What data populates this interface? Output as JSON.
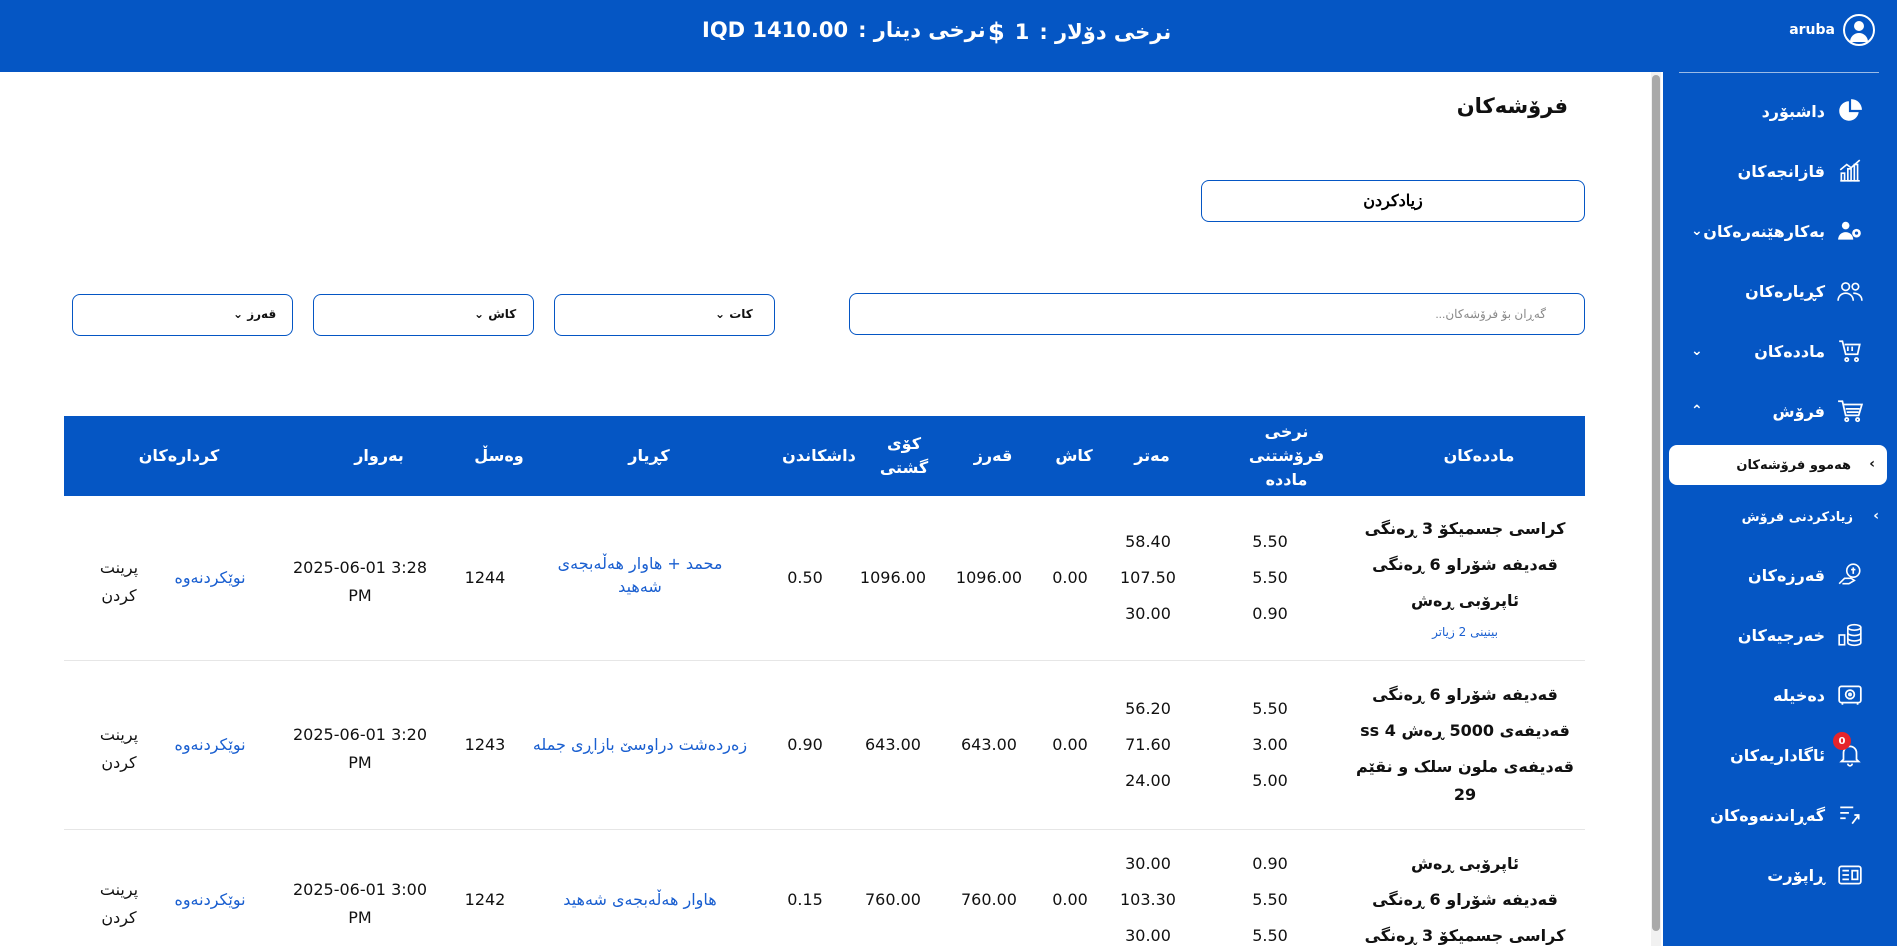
{
  "header": {
    "dollar_label": "نرخی دۆلار :",
    "dollar_value": "1",
    "dollar_icon": "dollar-sign-icon",
    "dinar_label": "نرخی دینار :",
    "dinar_value": "IQD 1410.00",
    "username": "aruba"
  },
  "sidebar": {
    "items": [
      {
        "label": "داشبۆرد",
        "icon": "pie-chart-icon"
      },
      {
        "label": "قازانجەکان",
        "icon": "growth-chart-icon"
      },
      {
        "label": "بەکارهێنەرەکان",
        "icon": "users-cog-icon"
      },
      {
        "label": "کڕیارەکان",
        "icon": "customers-icon"
      },
      {
        "label": "ماددەکان",
        "icon": "shopping-basket-icon"
      },
      {
        "label": "فرۆش",
        "icon": "cart-icon"
      },
      {
        "label": "قەرزەکان",
        "icon": "debt-icon"
      },
      {
        "label": "خەرجیەکان",
        "icon": "coins-stack-icon"
      },
      {
        "label": "دەخیلە",
        "icon": "safe-icon"
      },
      {
        "label": "ئاگاداریەکان",
        "icon": "bell-icon"
      },
      {
        "label": "گەڕاندنەوەکان",
        "icon": "returns-icon"
      },
      {
        "label": "ڕاپۆرت",
        "icon": "report-icon"
      }
    ],
    "sub_items": [
      "هەموو فرۆشەکان",
      "زیادکردنی فرۆش"
    ],
    "notification_count": "0"
  },
  "main": {
    "title": "فرۆشەکان",
    "add_button": "زیادکردن",
    "search_placeholder": "گەڕان بۆ فرۆشەکان...",
    "filters": [
      "کات",
      "کاش",
      "قەرز"
    ]
  },
  "table": {
    "headers": {
      "materials": "ماددەکان",
      "sale_price": "نرخی فرۆشتنی ماددە",
      "meter": "مەتر",
      "cash": "کاش",
      "debt": "قەرز",
      "total": "کۆی گشتی",
      "discount": "داشکاندن",
      "customer": "کڕیار",
      "receipt": "وەسڵ",
      "date": "بەروار",
      "actions": "کردارەکان"
    },
    "rows": [
      {
        "materials": [
          "کراسی جسمیکۆ 3 ڕەنگی",
          "قەدیفە شۆراو 6 ڕەنگی",
          "ئاپرۆبی ڕەش"
        ],
        "more": "بینینی 2 زیاتر",
        "prices": [
          "5.50",
          "5.50",
          "0.90"
        ],
        "meters": [
          "58.40",
          "107.50",
          "30.00"
        ],
        "cash": "0.00",
        "debt": "1096.00",
        "total": "1096.00",
        "discount": "0.50",
        "customer": [
          "محمد + هاوار هەڵەبجەی",
          "شەهید"
        ],
        "receipt": "1244",
        "date": [
          "2025-06-01 3:28",
          "PM"
        ],
        "edit": "نوێکردنەوە",
        "print": [
          "پرینت",
          "کردن"
        ]
      },
      {
        "materials": [
          "قەدیفە شۆراو 6 ڕەنگی",
          "قەدیفەی 5000 ڕەش 4 ss",
          "قەدیفەی ملون سلک و نقێم",
          "29"
        ],
        "prices": [
          "5.50",
          "3.00",
          "5.00"
        ],
        "meters": [
          "56.20",
          "71.60",
          "24.00"
        ],
        "cash": "0.00",
        "debt": "643.00",
        "total": "643.00",
        "discount": "0.90",
        "customer": [
          "زەردەشت دراوسێ بازاڕی جملە"
        ],
        "receipt": "1243",
        "date": [
          "2025-06-01 3:20",
          "PM"
        ],
        "edit": "نوێکردنەوە",
        "print": [
          "پرینت",
          "کردن"
        ]
      },
      {
        "materials": [
          "ئاپرۆبی ڕەش",
          "قەدیفە شۆراو 6 ڕەنگی",
          "کراسی جسمیکۆ 3 ڕەنگی"
        ],
        "prices": [
          "0.90",
          "5.50",
          "5.50"
        ],
        "meters": [
          "30.00",
          "103.30",
          "30.00"
        ],
        "cash": "0.00",
        "debt": "760.00",
        "total": "760.00",
        "discount": "0.15",
        "customer": [
          "هاوار هەڵەبجەی شەهید"
        ],
        "receipt": "1242",
        "date": [
          "2025-06-01 3:00",
          "PM"
        ],
        "edit": "نوێکردنەوە",
        "print": [
          "پرینت",
          "کردن"
        ]
      }
    ]
  },
  "colors": {
    "primary": "#0556c4",
    "link": "#1a5fd0",
    "badge": "#e5242b"
  }
}
